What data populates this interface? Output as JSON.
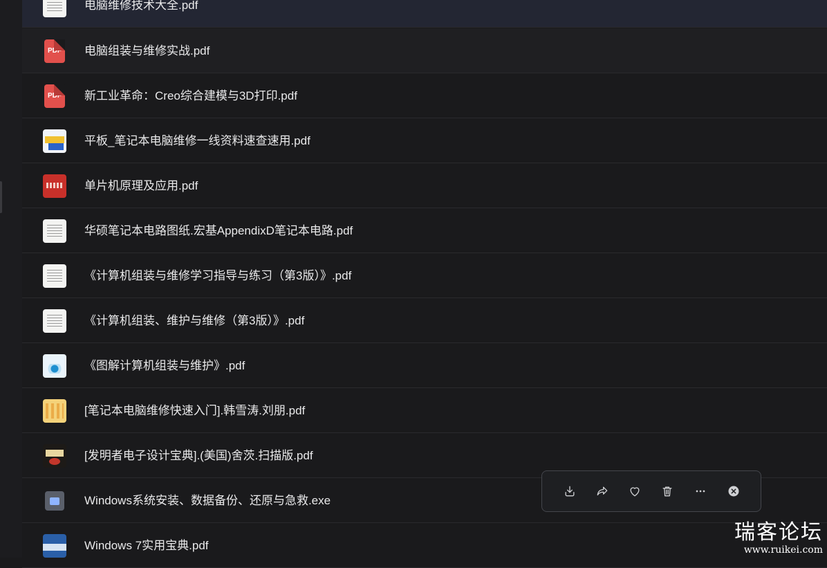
{
  "files": [
    {
      "name": "电脑维修技术大全.pdf",
      "thumb": "white"
    },
    {
      "name": "电脑组装与维修实战.pdf",
      "thumb": "pdf"
    },
    {
      "name": "新工业革命：Creo综合建模与3D打印.pdf",
      "thumb": "pdf"
    },
    {
      "name": "平板_笔记本电脑维修一线资料速查速用.pdf",
      "thumb": "blue"
    },
    {
      "name": "单片机原理及应用.pdf",
      "thumb": "red"
    },
    {
      "name": "华硕笔记本电路图纸.宏基AppendixD笔记本电路.pdf",
      "thumb": "white"
    },
    {
      "name": "《计算机组装与维修学习指导与练习（第3版）》.pdf",
      "thumb": "white"
    },
    {
      "name": "《计算机组装、维护与维修（第3版）》.pdf",
      "thumb": "white"
    },
    {
      "name": "《图解计算机组装与维护》.pdf",
      "thumb": "cyan"
    },
    {
      "name": "[笔记本电脑维修快速入门].韩雪涛.刘朋.pdf",
      "thumb": "yellow"
    },
    {
      "name": "[发明者电子设计宝典].(美国)舍茨.扫描版.pdf",
      "thumb": "dark"
    },
    {
      "name": "Windows系统安装、数据备份、还原与急救.exe",
      "thumb": "exe"
    },
    {
      "name": "Windows 7实用宝典.pdf",
      "thumb": "navy"
    }
  ],
  "pdf_badge": "PDF",
  "toolbar": {
    "download_icon": "download-icon",
    "share_icon": "share-icon",
    "favorite_icon": "heart-icon",
    "delete_icon": "trash-icon",
    "more_icon": "more-icon",
    "close_icon": "close-icon"
  },
  "watermark": {
    "title": "瑞客论坛",
    "url": "www.ruikei.com"
  },
  "colors": {
    "background": "#1a1a1c",
    "selected_row": "#232633",
    "pdf_red": "#e2504c",
    "text": "#e9e9ea"
  }
}
